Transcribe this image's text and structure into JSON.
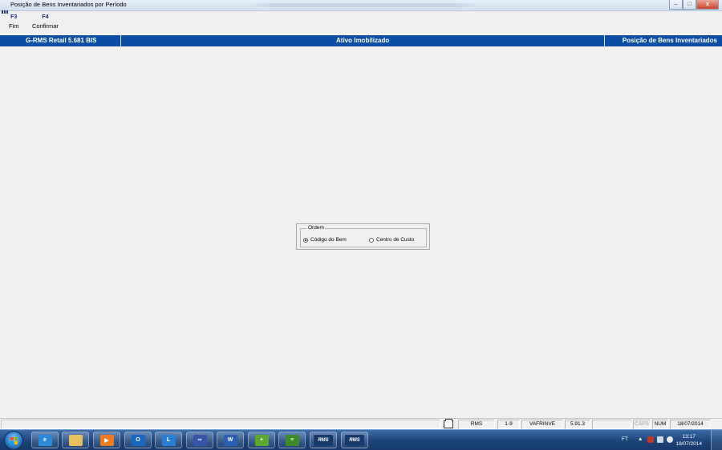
{
  "window": {
    "title": "Posição de Bens Inventariados por Período",
    "controls": {
      "minimize": "–",
      "maximize": "□",
      "close": "x"
    }
  },
  "function_keys": [
    {
      "key": "F3",
      "label": "Fim"
    },
    {
      "key": "F4",
      "label": "Confirmar"
    }
  ],
  "header": {
    "left": "G-RMS Retail 5.681 BIS",
    "center": "Ativo Imobilizado",
    "right": "Posição de Bens Inventariados"
  },
  "ordem": {
    "legend": "Ordem",
    "options": [
      {
        "label": "Código do Bem",
        "selected": true
      },
      {
        "label": "Centro de Custo",
        "selected": false
      }
    ]
  },
  "statusbar": {
    "cells": [
      "RMS",
      "1-9",
      "VAFRINVE",
      "5.91.3",
      "",
      "CAPS",
      "NUM",
      "18/07/2014"
    ]
  },
  "taskbar": {
    "apps": [
      {
        "name": "ie-icon",
        "text": "e",
        "color": "#2a8ad8"
      },
      {
        "name": "explorer-icon",
        "text": "",
        "color": "#e8c060"
      },
      {
        "name": "media-player-icon",
        "text": "▶",
        "color": "#f07a1e"
      },
      {
        "name": "outlook-icon",
        "text": "O",
        "color": "#1a66c2"
      },
      {
        "name": "lync-icon",
        "text": "L",
        "color": "#2a7fd4"
      },
      {
        "name": "vpn-icon",
        "text": "∞",
        "color": "#3656a8"
      },
      {
        "name": "word-icon",
        "text": "W",
        "color": "#2b5fb3"
      },
      {
        "name": "db-tool-icon",
        "text": "+",
        "color": "#5aa82e"
      },
      {
        "name": "stack-tool-icon",
        "text": "≡",
        "color": "#3f8b2c"
      },
      {
        "name": "rms-icon",
        "text": "RMS",
        "color": "#163a6a"
      },
      {
        "name": "rms-icon",
        "text": "RMS",
        "color": "#163a6a"
      }
    ],
    "tray": {
      "language": "FT",
      "time": "13:17",
      "date": "18/07/2014"
    }
  }
}
